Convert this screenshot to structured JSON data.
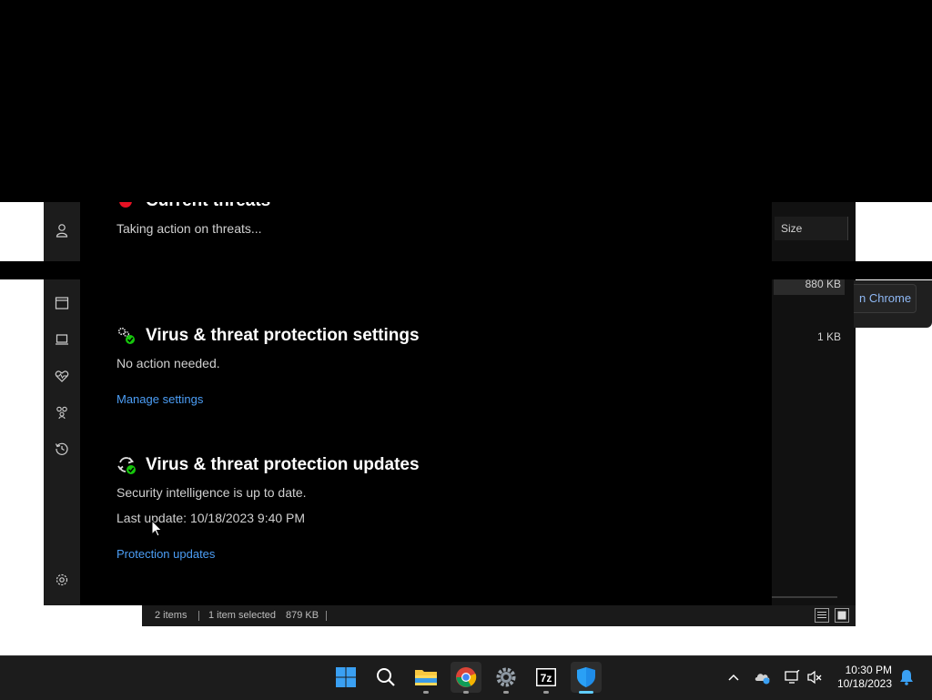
{
  "defender": {
    "current_threats": {
      "title": "Current threats",
      "status": "Taking action on threats..."
    },
    "settings": {
      "title": "Virus & threat protection settings",
      "status": "No action needed.",
      "link": "Manage settings"
    },
    "updates": {
      "title": "Virus & threat protection updates",
      "status": "Security intelligence is up to date.",
      "last_update": "Last update: 10/18/2023 9:40 PM",
      "link": "Protection updates"
    },
    "left_nav_icons": [
      "account-icon",
      "app-browser-icon",
      "device-security-icon",
      "device-health-icon",
      "family-icon",
      "history-icon",
      "settings-icon"
    ]
  },
  "explorer": {
    "column_size": "Size",
    "rows": [
      {
        "size": "880 KB"
      },
      {
        "size": "1 KB"
      }
    ],
    "status": {
      "items": "2 items",
      "selected": "1 item selected",
      "selected_size": "879 KB"
    }
  },
  "chrome_button": {
    "label": "n Chrome"
  },
  "taskbar": {
    "apps": [
      "start-icon",
      "search-icon",
      "file-explorer-icon",
      "chrome-icon",
      "settings-icon",
      "7zip-icon",
      "windows-security-icon"
    ],
    "time": "10:30 PM",
    "date": "10/18/2023"
  },
  "colors": {
    "link": "#4c9ef6",
    "accent": "#60cdff",
    "ok_green": "#16c60c"
  }
}
